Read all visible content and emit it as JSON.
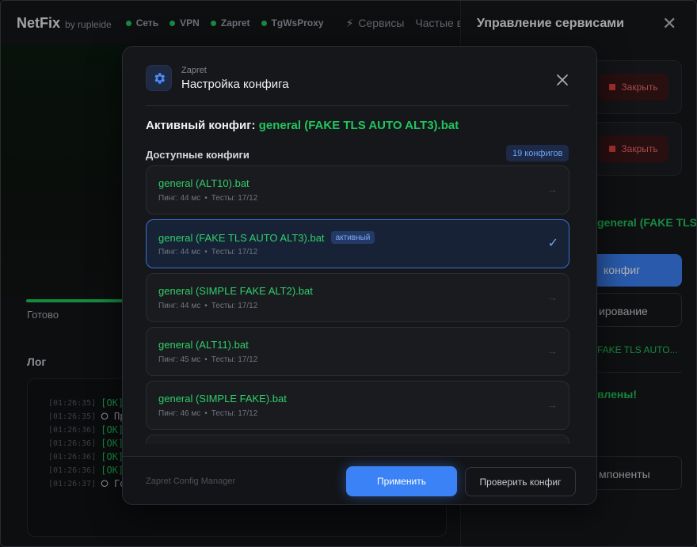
{
  "app": {
    "brand": "NetFix",
    "brand_by": "by rupleide",
    "statuses": [
      "Сеть",
      "VPN",
      "Zapret",
      "TgWsProxy"
    ],
    "nav": [
      "Сервисы",
      "Частые в"
    ],
    "progress_percent": 37,
    "progress_label": "Готово",
    "log_title": "Лог",
    "log": [
      {
        "time": "[01:26:35]",
        "text": "[OK] И",
        "kind": "ok"
      },
      {
        "time": "[01:26:35]",
        "text": "⭘ Пр",
        "kind": "info"
      },
      {
        "time": "[01:26:36]",
        "text": "[OK] Z",
        "kind": "ok"
      },
      {
        "time": "[01:26:36]",
        "text": "[OK] Z",
        "kind": "ok"
      },
      {
        "time": "[01:26:36]",
        "text": "[OK] tg",
        "kind": "ok"
      },
      {
        "time": "[01:26:36]",
        "text": "[OK] tg",
        "kind": "ok"
      },
      {
        "time": "[01:26:37]",
        "text": "⭘ Гот",
        "kind": "info"
      }
    ]
  },
  "side_panel": {
    "title": "Управление сервисами",
    "close_service_label": "Закрыть",
    "current_config": "general (FAKE TLS",
    "config_button": "конфиг",
    "diag_button": "ирование",
    "config_link": "FAKE TLS AUTO...",
    "success_text": "влены!",
    "components_button": "мпоненты"
  },
  "modal": {
    "subtitle": "Zapret",
    "title": "Настройка конфига",
    "active_prefix": "Активный конфиг:",
    "active_config": "general (FAKE TLS AUTO ALT3).bat",
    "available_label": "Доступные конфиги",
    "count_badge": "19 конфигов",
    "active_tag": "активный",
    "configs": [
      {
        "name": "general (ALT10).bat",
        "ping": "Пинг: 44 мс",
        "tests": "Тесты: 17/12"
      },
      {
        "name": "general (FAKE TLS AUTO ALT3).bat",
        "ping": "Пинг: 44 мс",
        "tests": "Тесты: 17/12"
      },
      {
        "name": "general (SIMPLE FAKE ALT2).bat",
        "ping": "Пинг: 44 мс",
        "tests": "Тесты: 17/12"
      },
      {
        "name": "general (ALT11).bat",
        "ping": "Пинг: 45 мс",
        "tests": "Тесты: 17/12"
      },
      {
        "name": "general (SIMPLE FAKE).bat",
        "ping": "Пинг: 46 мс",
        "tests": "Тесты: 17/12"
      }
    ],
    "footer_note": "Zapret Config Manager",
    "apply_label": "Применить",
    "check_label": "Проверить конфиг"
  },
  "colors": {
    "accent_blue": "#3b82f6",
    "success_green": "#22c55e",
    "danger_red": "#ef4444"
  }
}
